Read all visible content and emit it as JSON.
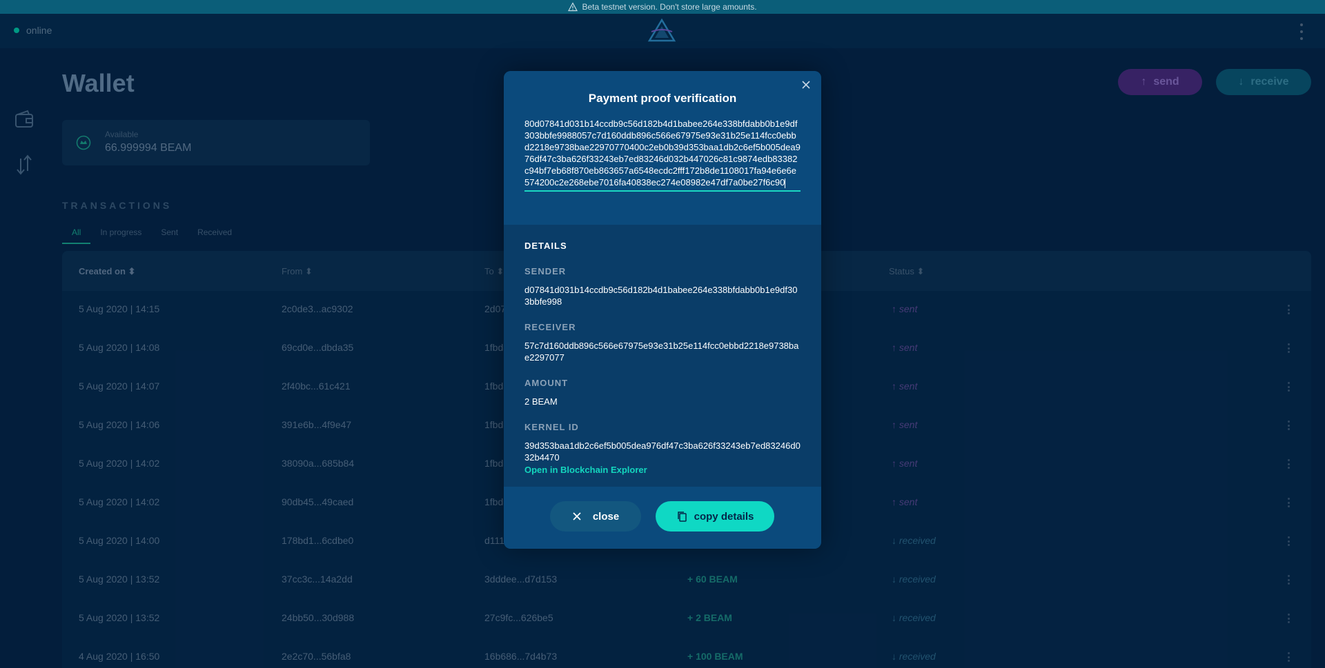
{
  "banner": {
    "text": "Beta testnet version. Don't store large amounts."
  },
  "status": {
    "label": "online"
  },
  "page": {
    "title": "Wallet"
  },
  "actions": {
    "send_label": "send",
    "receive_label": "receive"
  },
  "balance": {
    "label": "Available",
    "value": "66.999994 BEAM"
  },
  "transactions": {
    "title": "TRANSACTIONS",
    "tabs": [
      "All",
      "In progress",
      "Sent",
      "Received"
    ],
    "active_tab": "All",
    "columns": {
      "created": "Created on ⬍",
      "from": "From ⬍",
      "to": "To ⬍",
      "status": "Status ⬍"
    },
    "rows": [
      {
        "created": "5 Aug 2020 | 14:15",
        "from": "2c0de3...ac9302",
        "to": "2d07",
        "amount": "",
        "status": "sent"
      },
      {
        "created": "5 Aug 2020 | 14:08",
        "from": "69cd0e...dbda35",
        "to": "1fbd8",
        "amount": "",
        "status": "sent"
      },
      {
        "created": "5 Aug 2020 | 14:07",
        "from": "2f40bc...61c421",
        "to": "1fbd8",
        "amount": "",
        "status": "sent"
      },
      {
        "created": "5 Aug 2020 | 14:06",
        "from": "391e6b...4f9e47",
        "to": "1fbd8",
        "amount": "",
        "status": "sent"
      },
      {
        "created": "5 Aug 2020 | 14:02",
        "from": "38090a...685b84",
        "to": "1fbd8",
        "amount": "",
        "status": "sent"
      },
      {
        "created": "5 Aug 2020 | 14:02",
        "from": "90db45...49caed",
        "to": "1fbd8",
        "amount": "",
        "status": "sent"
      },
      {
        "created": "5 Aug 2020 | 14:00",
        "from": "178bd1...6cdbe0",
        "to": "d1112",
        "amount": "",
        "status": "received"
      },
      {
        "created": "5 Aug 2020 | 13:52",
        "from": "37cc3c...14a2dd",
        "to": "3dddee...d7d153",
        "amount": "+ 60 BEAM",
        "status": "received"
      },
      {
        "created": "5 Aug 2020 | 13:52",
        "from": "24bb50...30d988",
        "to": "27c9fc...626be5",
        "amount": "+ 2 BEAM",
        "status": "received"
      },
      {
        "created": "4 Aug 2020 | 16:50",
        "from": "2e2c70...56bfa8",
        "to": "16b686...7d4b73",
        "amount": "+ 100 BEAM",
        "status": "received"
      }
    ]
  },
  "modal": {
    "title": "Payment proof verification",
    "proof": "80d07841d031b14ccdb9c56d182b4d1babee264e338bfdabb0b1e9df303bbfe9988057c7d160ddb896c566e67975e93e31b25e114fcc0ebbd2218e9738bae22970770400c2eb0b39d353baa1db2c6ef5b005dea976df47c3ba626f33243eb7ed83246d032b447026c81c9874edb83382c94bf7eb68f870eb863657a6548ecdc2fff172b8de1108017fa94e6e6e574200c2e268ebe7016fa40838ec274e08982e47df7a0be27f6c90",
    "details_label": "DETAILS",
    "sender_label": "SENDER",
    "sender": "d07841d031b14ccdb9c56d182b4d1babee264e338bfdabb0b1e9df303bbfe998",
    "receiver_label": "RECEIVER",
    "receiver": "57c7d160ddb896c566e67975e93e31b25e114fcc0ebbd2218e9738bae2297077",
    "amount_label": "AMOUNT",
    "amount": "2 BEAM",
    "kernel_label": "KERNEL ID",
    "kernel": "39d353baa1db2c6ef5b005dea976df47c3ba626f33243eb7ed83246d032b4470",
    "explorer_link": "Open in Blockchain Explorer",
    "close_label": "close",
    "copy_label": "copy details"
  },
  "colors": {
    "accent": "#0fd8c4",
    "send": "#4a2a7e",
    "receive": "#0a5876",
    "background": "#042548"
  }
}
